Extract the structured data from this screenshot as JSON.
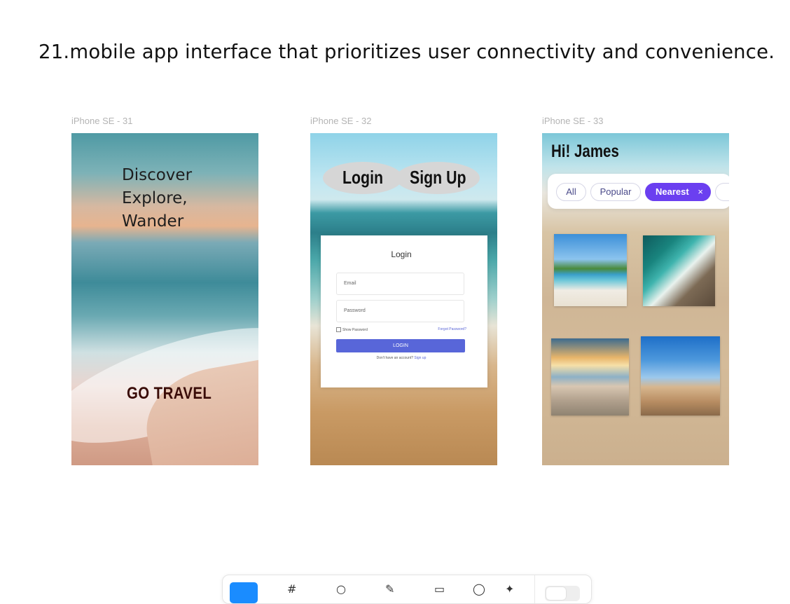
{
  "heading": "21.mobile app interface that prioritizes user connectivity and convenience.",
  "frames": {
    "f1": {
      "label": "iPhone SE - 31",
      "tagline": [
        "Discover",
        "Explore,",
        "Wander"
      ],
      "cta": "GO TRAVEL"
    },
    "f2": {
      "label": "iPhone SE - 32",
      "tab_login": "Login",
      "tab_signup": "Sign Up",
      "card": {
        "title": "Login",
        "email_placeholder": "Email",
        "password_placeholder": "Password",
        "show_password": "Show Password",
        "forgot": "Forgot Password?",
        "button": "LOGIN",
        "no_account": "Don't have an account?",
        "signup_link": "Sign up"
      }
    },
    "f3": {
      "label": "iPhone SE - 33",
      "greeting": "Hi! James",
      "filters": [
        "All",
        "Popular",
        "Nearest"
      ],
      "active_filter_close": "×"
    }
  },
  "toolbar": {
    "icons": [
      "move-tool-icon",
      "frame-tool-icon",
      "shape-tool-icon",
      "pen-tool-icon",
      "text-tool-icon",
      "comment-tool-icon",
      "actions-tool-icon",
      "mode-toggle"
    ],
    "accent": "#1a8cff"
  },
  "colors": {
    "primary_button": "#5866d9",
    "nearest_chip": "#6b3ff0"
  }
}
